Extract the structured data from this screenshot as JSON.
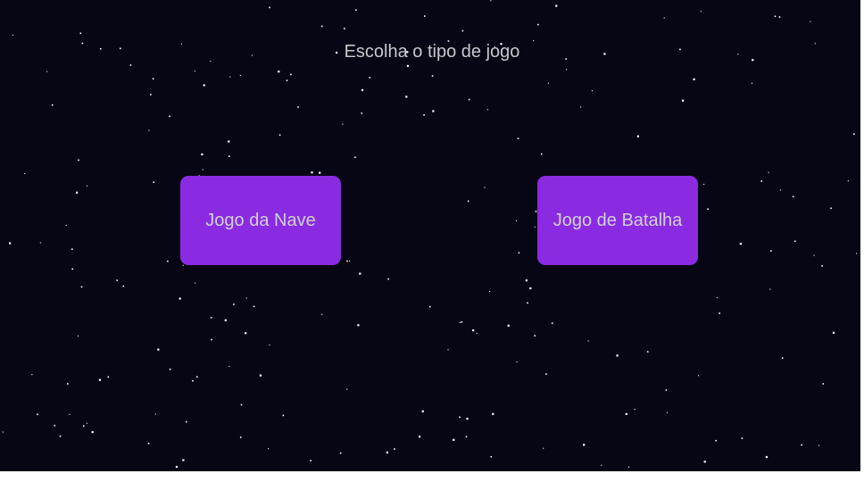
{
  "menu": {
    "title": "Escolha o tipo de jogo",
    "buttons": [
      {
        "label": "Jogo da Nave"
      },
      {
        "label": "Jogo de Batalha"
      }
    ]
  },
  "colors": {
    "background": "#060614",
    "button": "#8a2be2",
    "text": "#c8c8cc",
    "star": "#ffffff"
  }
}
